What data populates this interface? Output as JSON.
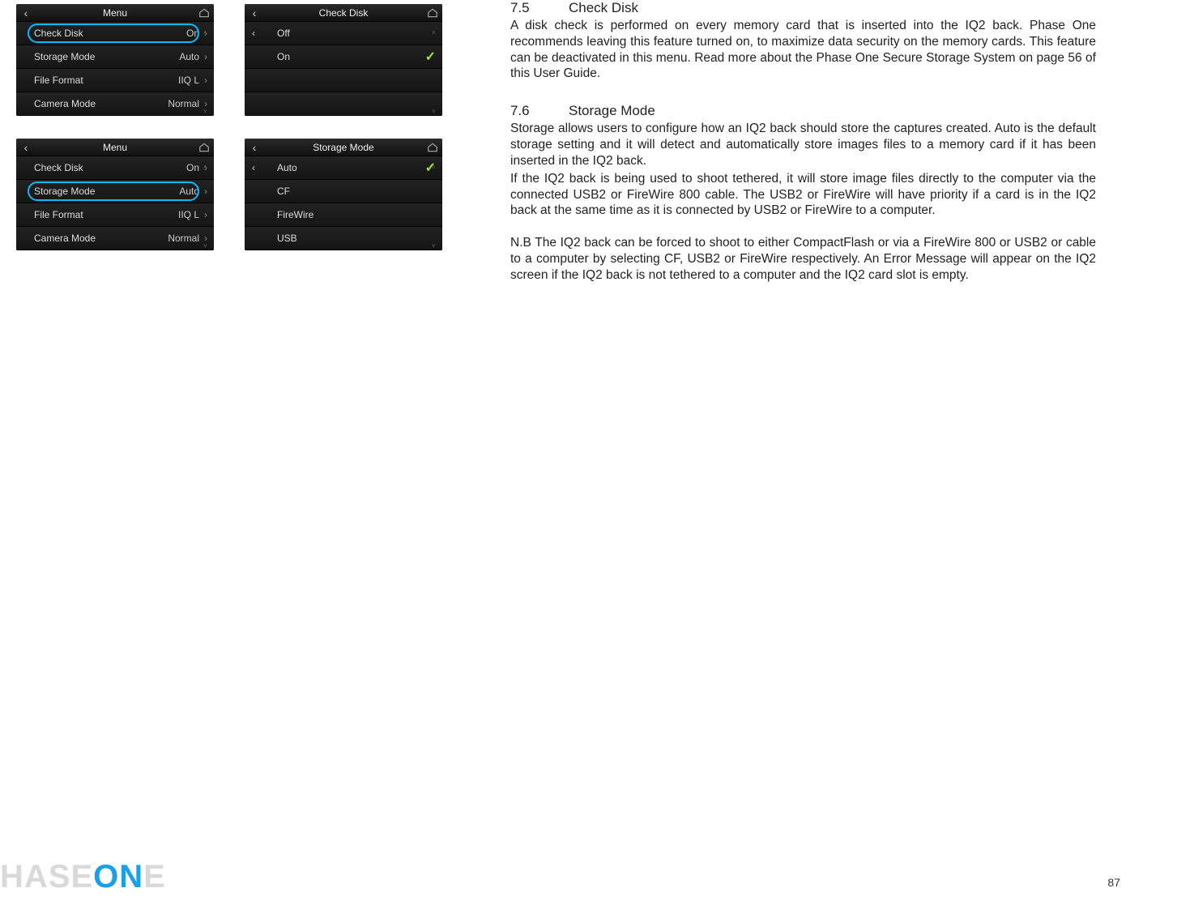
{
  "screens": {
    "menu1": {
      "title": "Menu",
      "rows": [
        {
          "label": "Check Disk",
          "value": "On",
          "highlight": true
        },
        {
          "label": "Storage Mode",
          "value": "Auto",
          "highlight": false
        },
        {
          "label": "File Format",
          "value": "IIQ L",
          "highlight": false
        },
        {
          "label": "Camera Mode",
          "value": "Normal",
          "highlight": false
        }
      ]
    },
    "checkdisk": {
      "title": "Check Disk",
      "options": [
        {
          "label": "Off",
          "checked": false
        },
        {
          "label": "On",
          "checked": true
        }
      ]
    },
    "menu2": {
      "title": "Menu",
      "rows": [
        {
          "label": "Check Disk",
          "value": "On",
          "highlight": false
        },
        {
          "label": "Storage Mode",
          "value": "Auto",
          "highlight": true
        },
        {
          "label": "File Format",
          "value": "IIQ L",
          "highlight": false
        },
        {
          "label": "Camera Mode",
          "value": "Normal",
          "highlight": false
        }
      ]
    },
    "storagemode": {
      "title": "Storage Mode",
      "options": [
        {
          "label": "Auto",
          "checked": true
        },
        {
          "label": "CF",
          "checked": false
        },
        {
          "label": "FireWire",
          "checked": false
        },
        {
          "label": "USB",
          "checked": false
        }
      ]
    }
  },
  "text": {
    "s75_num": "7.5",
    "s75_title": "Check Disk",
    "s75_body": "A disk check is performed on every memory card that is inserted into the  IQ2 back. Phase One recommends leaving this feature turned on, to maximize data security on the memory cards. This feature can be deactivated in this menu. Read more about the Phase One Secure Storage System on page 56 of this User Guide.",
    "s76_num": "7.6",
    "s76_title": "Storage Mode",
    "s76_body1": "Storage allows users to configure how an IQ2 back should store the captures created. Auto is the default storage setting and it will detect and automatically store images files to a memory card if it has been inserted in the IQ2 back.",
    "s76_body2": "If the IQ2 back is being used to shoot tethered, it will store image files directly to the computer via the connected USB2 or FireWire 800 cable. The USB2 or FireWire will have priority if a card is in the IQ2 back at the same time as it is connected by USB2 or FireWire to a computer.",
    "s76_body3": "N.B The IQ2 back can be forced to shoot to either CompactFlash or via a FireWire 800 or USB2 or cable to a computer by selecting CF, USB2 or FireWire respectively. An Error Message will appear on the IQ2 screen if the IQ2 back is not tethered to a computer and the IQ2 card slot is empty."
  },
  "footer": {
    "logo_a": "HASE",
    "logo_b": "ON",
    "logo_c": "E",
    "page": "87"
  },
  "glyphs": {
    "back": "‹",
    "chev": "›",
    "up": "˄",
    "down": "˅",
    "check": "✓"
  }
}
